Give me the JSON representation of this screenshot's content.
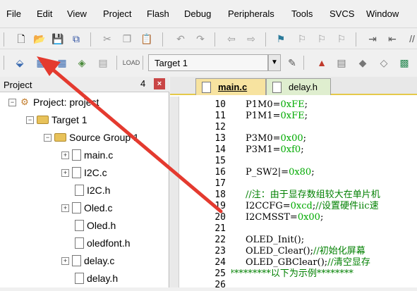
{
  "menu": [
    "File",
    "Edit",
    "View",
    "Project",
    "Flash",
    "Debug",
    "Peripherals",
    "Tools",
    "SVCS",
    "Window"
  ],
  "toolbar2": {
    "target_select": "Target 1"
  },
  "project_panel": {
    "title": "Project",
    "pin": "4",
    "close": "×",
    "tree": [
      {
        "label": "Project: project",
        "level": 0,
        "kind": "project",
        "exp": "−"
      },
      {
        "label": "Target 1",
        "level": 1,
        "kind": "target",
        "exp": "−"
      },
      {
        "label": "Source Group 1",
        "level": 2,
        "kind": "folder",
        "exp": "−"
      },
      {
        "label": "main.c",
        "level": 3,
        "kind": "file",
        "exp": "+"
      },
      {
        "label": "I2C.c",
        "level": 3,
        "kind": "file",
        "exp": "+"
      },
      {
        "label": "I2C.h",
        "level": 3,
        "kind": "file",
        "exp": ""
      },
      {
        "label": "Oled.c",
        "level": 3,
        "kind": "file",
        "exp": "+"
      },
      {
        "label": "Oled.h",
        "level": 3,
        "kind": "file",
        "exp": ""
      },
      {
        "label": "oledfont.h",
        "level": 3,
        "kind": "file",
        "exp": ""
      },
      {
        "label": "delay.c",
        "level": 3,
        "kind": "file",
        "exp": "+"
      },
      {
        "label": "delay.h",
        "level": 3,
        "kind": "file",
        "exp": ""
      }
    ]
  },
  "editor": {
    "tabs": [
      {
        "label": "main.c",
        "active": true
      },
      {
        "label": "delay.h",
        "active": false
      }
    ],
    "lines": [
      {
        "n": "10",
        "text": "P1M0=",
        "val": "0xFE",
        "end": ";"
      },
      {
        "n": "11",
        "text": "P1M1=",
        "val": "0xFE",
        "end": ";"
      },
      {
        "n": "12",
        "text": "",
        "val": "",
        "end": ""
      },
      {
        "n": "13",
        "text": "P3M0=",
        "val": "0x00",
        "end": ";"
      },
      {
        "n": "14",
        "text": "P3M1=",
        "val": "0xf0",
        "end": ";"
      },
      {
        "n": "15",
        "text": "",
        "val": "",
        "end": ""
      },
      {
        "n": "16",
        "text": "P_SW2|=",
        "val": "0x80",
        "end": ";"
      },
      {
        "n": "17",
        "text": "",
        "val": "",
        "end": ""
      },
      {
        "n": "18",
        "text": "",
        "val": "",
        "end": "",
        "comment": "//注：由于显存数组较大在单片机"
      },
      {
        "n": "19",
        "text": "I2CCFG=",
        "val": "0xcd",
        "end": ";",
        "comment": "//设置硬件iic速"
      },
      {
        "n": "20",
        "text": "I2CMSST=",
        "val": "0x00",
        "end": ";"
      },
      {
        "n": "21",
        "text": "",
        "val": "",
        "end": ""
      },
      {
        "n": "22",
        "text": "OLED_Init();",
        "val": "",
        "end": ""
      },
      {
        "n": "23",
        "text": "OLED_Clear();",
        "val": "",
        "end": "",
        "comment": "//初始化屏幕"
      },
      {
        "n": "24",
        "text": "OLED_GBClear();",
        "val": "",
        "end": "",
        "comment": "//清空显存"
      },
      {
        "n": "25",
        "text": "",
        "val": "",
        "end": "",
        "comment": "/***********以下为示例********",
        "outdent": true
      },
      {
        "n": "26",
        "text": "",
        "val": "",
        "end": ""
      }
    ]
  },
  "colors": {
    "annotation_arrow": "#e43a2f",
    "tab_active": "#f7e3a0",
    "tab_inactive": "#dfeecf",
    "number": "#00aa00",
    "comment": "#008000"
  }
}
